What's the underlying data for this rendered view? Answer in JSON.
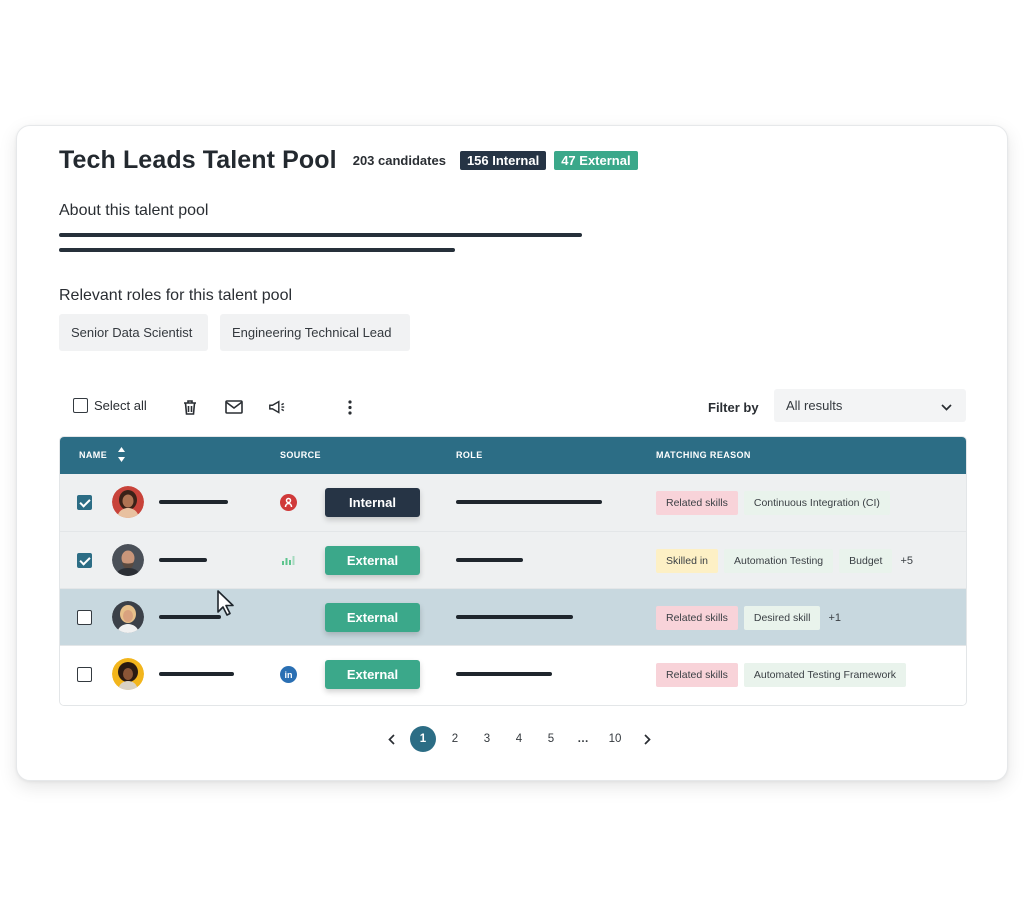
{
  "header": {
    "title": "Tech Leads Talent Pool",
    "candidates": "203 candidates",
    "internal_badge": "156 Internal",
    "external_badge": "47 External"
  },
  "about": {
    "heading": "About this talent pool"
  },
  "roles": {
    "heading": "Relevant roles for this talent pool",
    "items": [
      "Senior Data Scientist",
      "Engineering Technical Lead"
    ]
  },
  "toolbar": {
    "select_all": "Select all",
    "filter_label": "Filter by",
    "filter_value": "All results"
  },
  "table": {
    "columns": [
      "NAME",
      "SOURCE",
      "ROLE",
      "MATCHING REASON"
    ],
    "rows": [
      {
        "checked": true,
        "source": "Internal",
        "source_icon": "referral-icon",
        "reasons": [
          "Related skills",
          "Continuous Integration (CI)"
        ],
        "more": ""
      },
      {
        "checked": true,
        "source": "External",
        "source_icon": "signal-icon",
        "reasons": [
          "Skilled in",
          "Automation Testing",
          "Budget"
        ],
        "more": "+5"
      },
      {
        "checked": false,
        "source": "External",
        "source_icon": "",
        "reasons": [
          "Related skills",
          "Desired skill"
        ],
        "more": "+1"
      },
      {
        "checked": false,
        "source": "External",
        "source_icon": "linkedin-icon",
        "reasons": [
          "Related skills",
          "Automated Testing Framework"
        ],
        "more": ""
      }
    ]
  },
  "pagination": {
    "pages": [
      "1",
      "2",
      "3",
      "4",
      "5",
      "…",
      "10"
    ],
    "current": "1"
  },
  "colors": {
    "accent": "#2c6d85",
    "internal": "#263445",
    "external": "#3ba88a",
    "tag_pink": "#f8d3d9",
    "tag_yellow": "#fdf0c5",
    "tag_green": "#e9f3ec"
  }
}
